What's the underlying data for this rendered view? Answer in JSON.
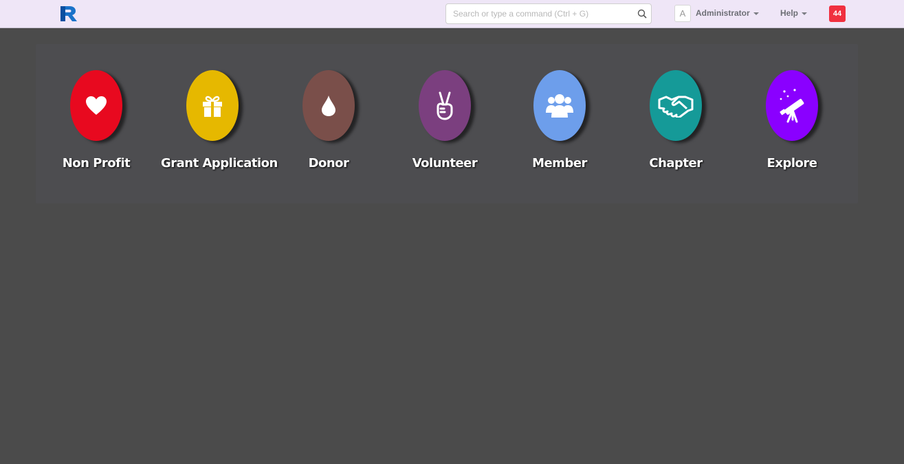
{
  "navbar": {
    "search_placeholder": "Search or type a command (Ctrl + G)",
    "avatar_letter": "A",
    "user_label": "Administrator",
    "help_label": "Help",
    "notification_count": "44"
  },
  "modules": [
    {
      "label": "Non Profit",
      "color": "#e8091f",
      "icon": "heart-icon"
    },
    {
      "label": "Grant Application",
      "color": "#e6b800",
      "icon": "gift-icon"
    },
    {
      "label": "Donor",
      "color": "#7a4f4a",
      "icon": "drop-icon"
    },
    {
      "label": "Volunteer",
      "color": "#7b3f7f",
      "icon": "peace-hand-icon"
    },
    {
      "label": "Member",
      "color": "#6d9eeb",
      "icon": "users-icon"
    },
    {
      "label": "Chapter",
      "color": "#159a98",
      "icon": "handshake-icon"
    },
    {
      "label": "Explore",
      "color": "#8a00ff",
      "icon": "telescope-icon"
    }
  ]
}
